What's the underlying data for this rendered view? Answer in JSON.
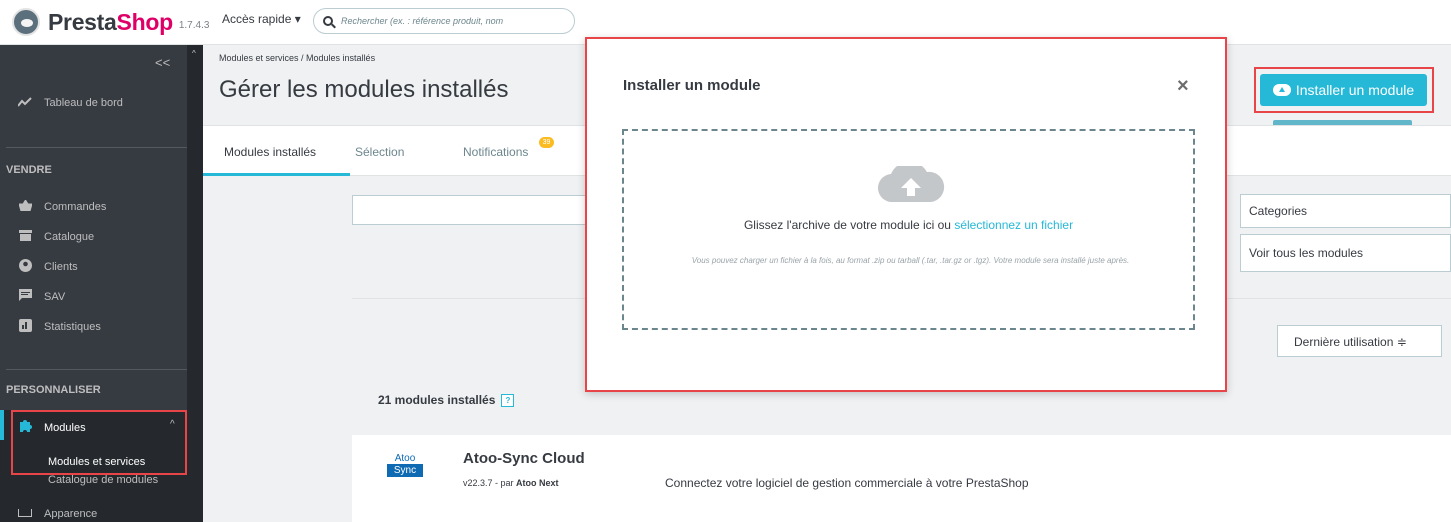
{
  "topbar": {
    "logo_text_1": "Presta",
    "logo_text_2": "Shop",
    "version": "1.7.4.3",
    "quick_access": "Accès rapide ▾",
    "search_placeholder": "Rechercher (ex. : référence produit, nom"
  },
  "sidebar": {
    "collapse": "<<",
    "dashboard": "Tableau de bord",
    "section_sell": "VENDRE",
    "orders": "Commandes",
    "catalog": "Catalogue",
    "customers": "Clients",
    "sav": "SAV",
    "stats": "Statistiques",
    "section_custom": "PERSONNALISER",
    "modules": "Modules",
    "modules_chevron": "^",
    "sub_modules_services": "Modules et services",
    "sub_modules_catalog": "Catalogue de modules",
    "next_item": "Apparence"
  },
  "header": {
    "breadcrumb": "Modules et services /  Modules installés",
    "title": "Gérer les modules installés",
    "install_button": "Installer un module",
    "install_tooltip": "Installer un module"
  },
  "tabs": {
    "installed": "Modules installés",
    "selection": "Sélection",
    "notifications": "Notifications",
    "notifications_count": "39"
  },
  "filters": {
    "categories": "Categories",
    "all_modules": "Voir tous les modules",
    "sort": "Dernière utilisation  ≑"
  },
  "list": {
    "count_label": "21 modules installés",
    "help": "?",
    "module": {
      "logo_top": "Atoo",
      "logo_bottom": "Sync",
      "name": "Atoo-Sync Cloud",
      "version_prefix": "v22.3.7 - par ",
      "author": "Atoo Next",
      "description": "Connectez votre logiciel de gestion commerciale à votre PrestaShop"
    }
  },
  "modal": {
    "title": "Installer un module",
    "close": "×",
    "drop_text": "Glissez l'archive de votre module ici ou ",
    "drop_link": "sélectionnez un fichier",
    "drop_note": "Vous pouvez charger un fichier à la fois, au format .zip ou tarball (.tar, .tar.gz or .tgz). Votre module sera installé juste après."
  }
}
